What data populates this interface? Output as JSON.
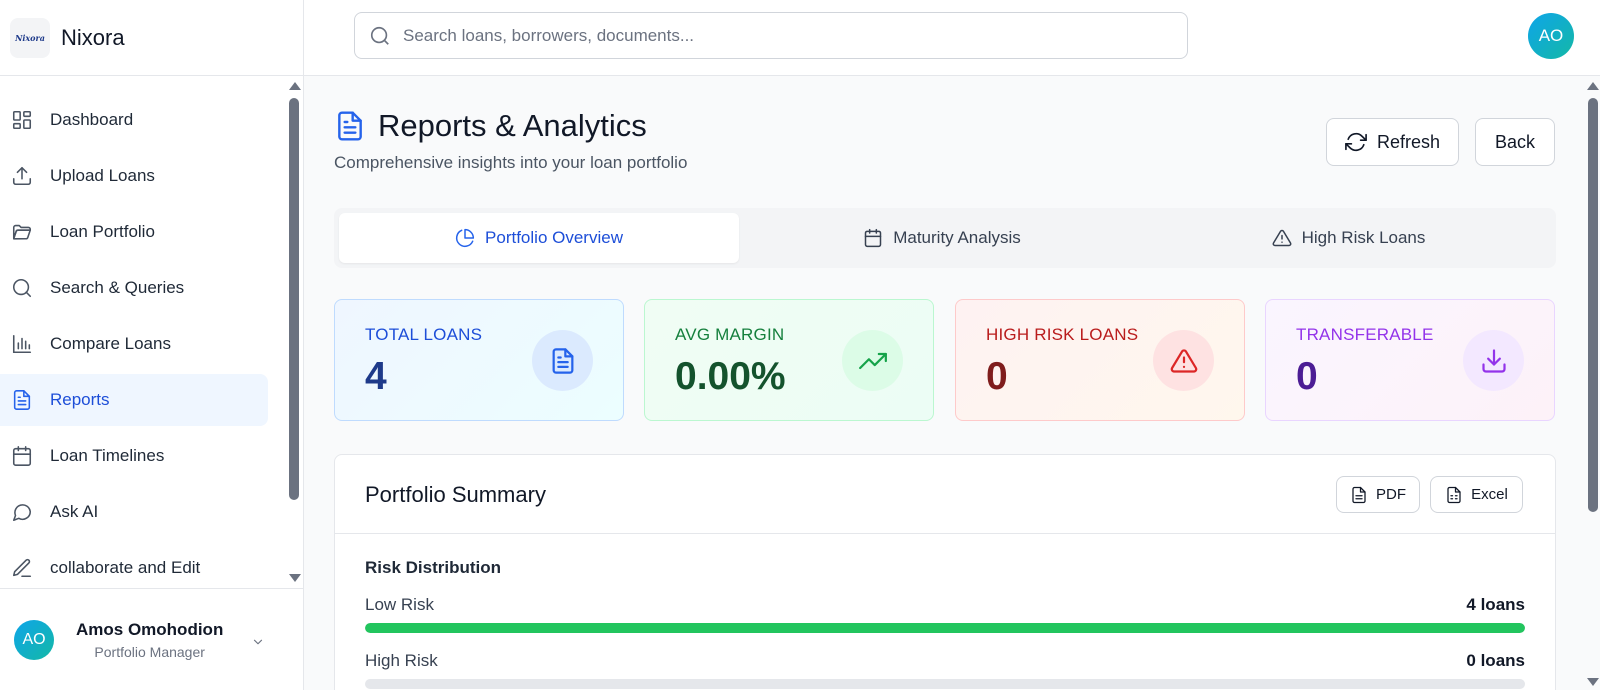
{
  "brand": {
    "logo_text": "Nixora",
    "name": "Nixora"
  },
  "search": {
    "placeholder": "Search loans, borrowers, documents..."
  },
  "user": {
    "initials": "AO",
    "name": "Amos Omohodion",
    "role": "Portfolio Manager"
  },
  "sidebar": {
    "items": [
      {
        "label": "Dashboard",
        "icon": "grid-icon",
        "active": false
      },
      {
        "label": "Upload Loans",
        "icon": "upload-icon",
        "active": false
      },
      {
        "label": "Loan Portfolio",
        "icon": "folder-icon",
        "active": false
      },
      {
        "label": "Search & Queries",
        "icon": "search-icon",
        "active": false
      },
      {
        "label": "Compare Loans",
        "icon": "bar-chart-icon",
        "active": false
      },
      {
        "label": "Reports",
        "icon": "document-icon",
        "active": true
      },
      {
        "label": "Loan Timelines",
        "icon": "calendar-icon",
        "active": false
      },
      {
        "label": "Ask AI",
        "icon": "chat-bubble-icon",
        "active": false
      },
      {
        "label": "collaborate and Edit",
        "icon": "pencil-icon",
        "active": false
      }
    ]
  },
  "page": {
    "title": "Reports & Analytics",
    "subtitle": "Comprehensive insights into your loan portfolio",
    "refresh_label": "Refresh",
    "back_label": "Back"
  },
  "tabs": [
    {
      "label": "Portfolio Overview",
      "icon": "pie-chart-icon",
      "active": true
    },
    {
      "label": "Maturity Analysis",
      "icon": "calendar-icon",
      "active": false
    },
    {
      "label": "High Risk Loans",
      "icon": "warning-icon",
      "active": false
    }
  ],
  "stats": [
    {
      "label": "TOTAL LOANS",
      "value": "4",
      "icon": "document-icon",
      "color": "#2563eb"
    },
    {
      "label": "AVG MARGIN",
      "value": "0.00%",
      "icon": "trending-up-icon",
      "color": "#16a34a"
    },
    {
      "label": "HIGH RISK LOANS",
      "value": "0",
      "icon": "warning-icon",
      "color": "#dc2626"
    },
    {
      "label": "TRANSFERABLE",
      "value": "0",
      "icon": "download-icon",
      "color": "#9333ea"
    }
  ],
  "summary": {
    "title": "Portfolio Summary",
    "pdf_label": "PDF",
    "excel_label": "Excel",
    "risk_title": "Risk Distribution",
    "risks": [
      {
        "label": "Low Risk",
        "count": "4 loans",
        "fraction": 1.0,
        "color": "#22c55e"
      },
      {
        "label": "High Risk",
        "count": "0 loans",
        "fraction": 0.0,
        "color": "#ef4444"
      }
    ]
  }
}
